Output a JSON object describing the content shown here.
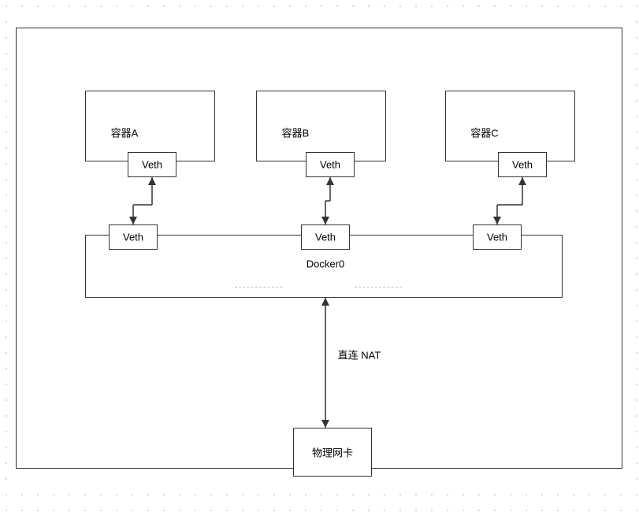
{
  "containers": {
    "a": {
      "label": "容器A"
    },
    "b": {
      "label": "容器B"
    },
    "c": {
      "label": "容器C"
    }
  },
  "veth": {
    "top_a": "Veth",
    "top_b": "Veth",
    "top_c": "Veth",
    "bridge_a": "Veth",
    "bridge_b": "Veth",
    "bridge_c": "Veth"
  },
  "bridge": {
    "label": "Docker0"
  },
  "link": {
    "nat_label": "直连 NAT"
  },
  "nic": {
    "label": "物理网卡"
  }
}
